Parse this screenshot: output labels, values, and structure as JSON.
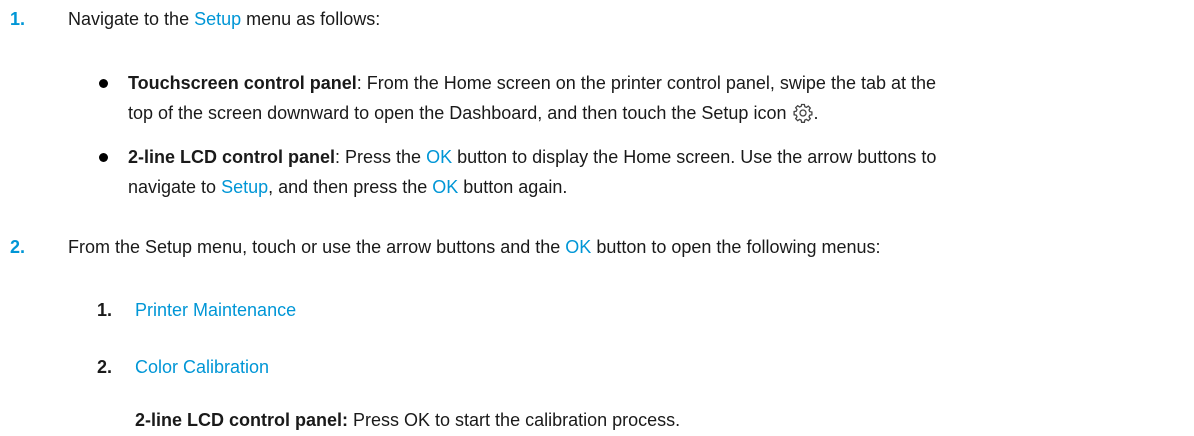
{
  "step1": {
    "number": "1.",
    "text_before": "Navigate to the ",
    "link": "Setup",
    "text_after": " menu as follows:",
    "bullets": [
      {
        "heading": "Touchscreen control panel",
        "line1": ": From the Home screen on the printer control panel, swipe the tab at the",
        "line2": "top of the screen downward to open the Dashboard, and then touch the Setup icon ",
        "line2_end": ".",
        "icon": "gear-icon"
      },
      {
        "heading": "2-line LCD control panel",
        "line1_a": ": Press the ",
        "line1_ok": "OK",
        "line1_b": " button to display the Home screen. Use the arrow buttons to",
        "line2_a": "navigate to ",
        "line2_setup": "Setup",
        "line2_b": ", and then press the ",
        "line2_ok": "OK",
        "line2_c": " button again."
      }
    ]
  },
  "step2": {
    "number": "2.",
    "text_a": "From the Setup menu, touch or use the arrow buttons and the ",
    "ok": "OK",
    "text_b": " button to open the following menus:",
    "substeps": [
      {
        "number": "1.",
        "label": "Printer Maintenance"
      },
      {
        "number": "2.",
        "label": "Color Calibration"
      }
    ],
    "note_heading": "2-line LCD control panel:",
    "note_text": " Press OK to start the calibration process."
  },
  "colors": {
    "accent": "#0096d6",
    "text": "#1a1a1a"
  }
}
